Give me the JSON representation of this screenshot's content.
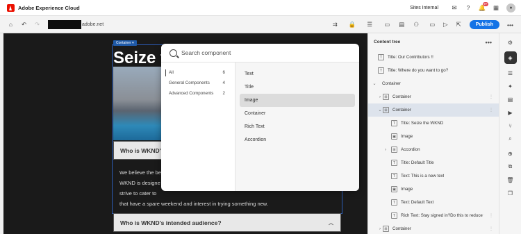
{
  "app": {
    "title": "Adobe Experience Cloud",
    "org": "Sites Internal",
    "notif_count": "9+",
    "avatar_initial": ""
  },
  "toolbar": {
    "url_suffix": "adobe.net",
    "publish_label": "Publish"
  },
  "canvas": {
    "container_badge": "Container",
    "heading": "Seize t",
    "accordion_title": "Who is WKND's",
    "body_lines": [
      "We believe the be",
      "WKND is designe",
      "strive to cater to",
      "that have a spare weekend and interest in trying something new."
    ],
    "accordion2_title": "Who is WKND's intended audience?"
  },
  "search": {
    "placeholder": "Search component",
    "categories": [
      {
        "label": "All",
        "count": "6"
      },
      {
        "label": "General Components",
        "count": "4"
      },
      {
        "label": "Advanced Components",
        "count": "2"
      }
    ],
    "components": [
      "Text",
      "Title",
      "Image",
      "Container",
      "Rich Text",
      "Accordion"
    ],
    "selected_component": "Image"
  },
  "panel": {
    "title": "Content tree",
    "items": [
      {
        "label": "Title: Our Contributors !!"
      },
      {
        "label": "Title: Where do you want to go?"
      },
      {
        "label": "Container"
      },
      {
        "label": "Container"
      },
      {
        "label": "Container"
      },
      {
        "label": "Title: Seize the WKND"
      },
      {
        "label": "Image"
      },
      {
        "label": "Accordion"
      },
      {
        "label": "Title: Default Title"
      },
      {
        "label": "Text: This is a new text"
      },
      {
        "label": "Image"
      },
      {
        "label": "Text: Default Text"
      },
      {
        "label": "Rich Text: Stay signed in?Do this to reduce t..."
      },
      {
        "label": "Container"
      }
    ]
  },
  "colors": {
    "accent": "#1473e6",
    "brand": "#eb1000",
    "selection": "#dde3ec"
  }
}
